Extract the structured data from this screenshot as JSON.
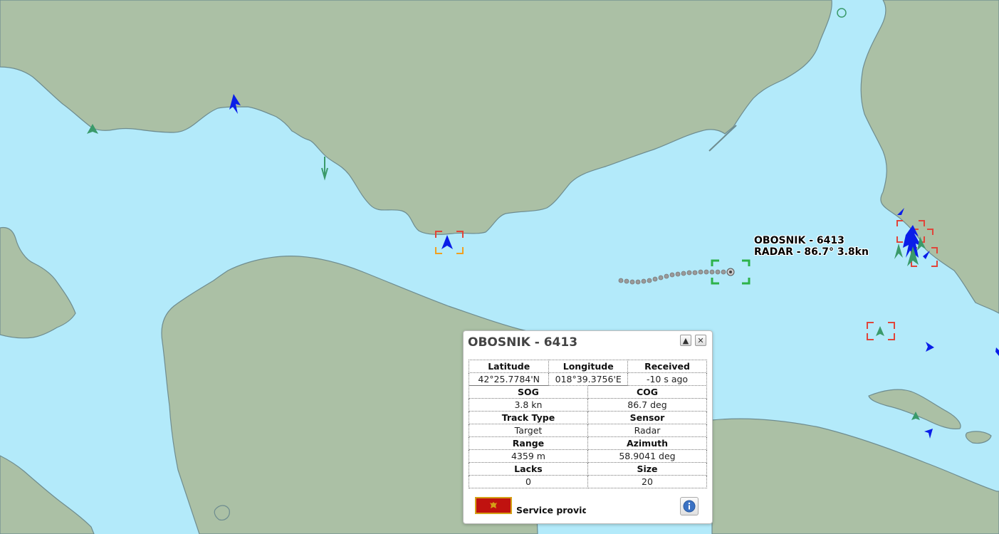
{
  "colors": {
    "water": "#b3eafa",
    "land": "#abc0a5",
    "coast": "#6e8c8f",
    "track_green": "#2db24a",
    "alarm_red": "#e0453a",
    "alarm_orange": "#f0a020",
    "vessel_blue": "#0a1ee8",
    "vessel_green": "#3a9a6a"
  },
  "map": {
    "target_label": {
      "line1": "OBOSNIK - 6413",
      "line2": "RADAR - 86.7° 3.8kn"
    }
  },
  "popup": {
    "title": "OBOSNIK - 6413",
    "collapse_icon": "triangle-up-icon",
    "close_icon": "close-icon",
    "position_table": {
      "headers": [
        "Latitude",
        "Longitude",
        "Received"
      ],
      "values": [
        "42°25.7784'N",
        "018°39.3756'E",
        "-10 s ago"
      ]
    },
    "detail_table": [
      {
        "label_a": "SOG",
        "value_a": "3.8 kn",
        "label_b": "COG",
        "value_b": "86.7 deg"
      },
      {
        "label_a": "Track Type",
        "value_a": "Target",
        "label_b": "Sensor",
        "value_b": "Radar"
      },
      {
        "label_a": "Range",
        "value_a": "4359 m",
        "label_b": "Azimuth",
        "value_b": "58.9041 deg"
      },
      {
        "label_a": "Lacks",
        "value_a": "0",
        "label_b": "Size",
        "value_b": "20"
      }
    ],
    "footer": {
      "flag_icon": "montenegro-flag-icon",
      "provider_text": "Service provide",
      "info_icon": "info-icon"
    }
  }
}
